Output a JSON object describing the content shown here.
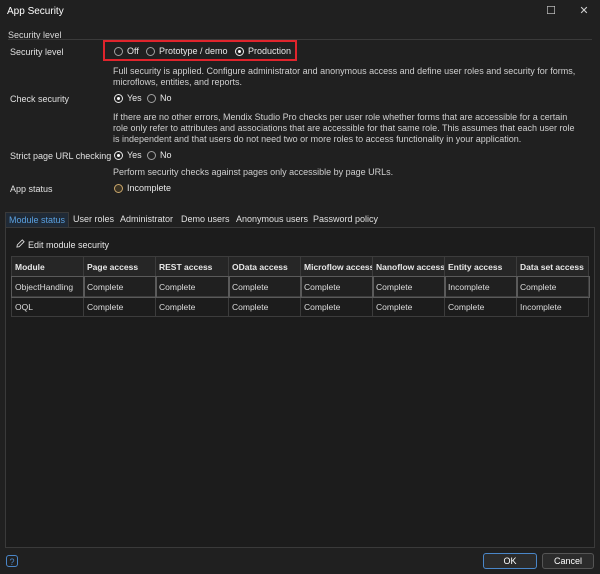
{
  "window": {
    "title": "App Security",
    "maximize_icon": "☐",
    "close_icon": "✕"
  },
  "security_group": {
    "label": "Security level"
  },
  "security_level": {
    "label": "Security level",
    "options": [
      {
        "label": "Off",
        "selected": false
      },
      {
        "label": "Prototype / demo",
        "selected": false
      },
      {
        "label": "Production",
        "selected": true
      }
    ],
    "description": "Full security is applied. Configure administrator and anonymous access and define user roles and security for forms, microflows, entities, and reports."
  },
  "check_security": {
    "label": "Check security",
    "options": [
      {
        "label": "Yes",
        "selected": true
      },
      {
        "label": "No",
        "selected": false
      }
    ],
    "description": "If there are no other errors, Mendix Studio Pro checks per user role whether forms that are accessible for a certain role only refer to attributes and associations that are accessible for that same role. This assumes that each user role is independent and that users do not need two or more roles to access functionality in your application."
  },
  "strict_url": {
    "label": "Strict page URL checking",
    "options": [
      {
        "label": "Yes",
        "selected": true
      },
      {
        "label": "No",
        "selected": false
      }
    ],
    "description": "Perform security checks against pages only accessible by page URLs."
  },
  "app_status": {
    "label": "App status",
    "value": "Incomplete"
  },
  "tabs": [
    "Module status",
    "User roles",
    "Administrator",
    "Demo users",
    "Anonymous users",
    "Password policy"
  ],
  "edit_button": {
    "label": "Edit module security"
  },
  "table": {
    "headers": [
      "Module",
      "Page access",
      "REST access",
      "OData access",
      "Microflow access",
      "Nanoflow access",
      "Entity access",
      "Data set access"
    ],
    "rows": [
      [
        "ObjectHandling",
        "Complete",
        "Complete",
        "Complete",
        "Complete",
        "Complete",
        "Incomplete",
        "Complete"
      ],
      [
        "OQL",
        "Complete",
        "Complete",
        "Complete",
        "Complete",
        "Complete",
        "Complete",
        "Incomplete"
      ]
    ]
  },
  "footer": {
    "help_label": "?",
    "ok_label": "OK",
    "cancel_label": "Cancel"
  },
  "colors": {
    "accent": "#4a86c8",
    "warning": "#e8924a",
    "highlight": "#e0242c"
  }
}
